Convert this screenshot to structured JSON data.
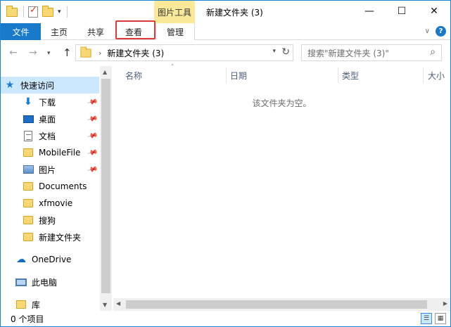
{
  "titlebar": {
    "context_tab": "图片工具",
    "title": "新建文件夹 (3)",
    "minimize": "—",
    "maximize": "☐",
    "close": "✕"
  },
  "ribbon": {
    "tabs": [
      {
        "label": "文件"
      },
      {
        "label": "主页"
      },
      {
        "label": "共享"
      },
      {
        "label": "查看"
      },
      {
        "label": "管理"
      }
    ],
    "collapse_icon": "chevron-down-icon",
    "help": "?"
  },
  "address": {
    "path": "新建文件夹 (3)",
    "search_placeholder": "搜索\"新建文件夹 (3)\""
  },
  "sidebar": {
    "items": [
      {
        "label": "快速访问",
        "icon": "star-icon"
      },
      {
        "label": "下载",
        "icon": "download-icon",
        "pinned": true
      },
      {
        "label": "桌面",
        "icon": "desktop-icon",
        "pinned": true
      },
      {
        "label": "文档",
        "icon": "document-icon",
        "pinned": true
      },
      {
        "label": "MobileFile",
        "icon": "folder-icon",
        "pinned": true
      },
      {
        "label": "图片",
        "icon": "pictures-icon",
        "pinned": true
      },
      {
        "label": "Documents",
        "icon": "folder-icon"
      },
      {
        "label": "xfmovie",
        "icon": "folder-icon"
      },
      {
        "label": "搜狗",
        "icon": "folder-icon"
      },
      {
        "label": "新建文件夹",
        "icon": "folder-icon"
      },
      {
        "label": "OneDrive",
        "icon": "cloud-icon"
      },
      {
        "label": "此电脑",
        "icon": "computer-icon"
      },
      {
        "label": "库",
        "icon": "library-icon"
      }
    ]
  },
  "content": {
    "columns": [
      "名称",
      "日期",
      "类型",
      "大小"
    ],
    "empty_message": "该文件夹为空。"
  },
  "status": {
    "item_count": "0 个项目"
  },
  "colors": {
    "accent": "#1979ca",
    "context_tab_bg": "#fbe99a",
    "highlight": "#e0393b",
    "selected": "#cce8ff"
  }
}
